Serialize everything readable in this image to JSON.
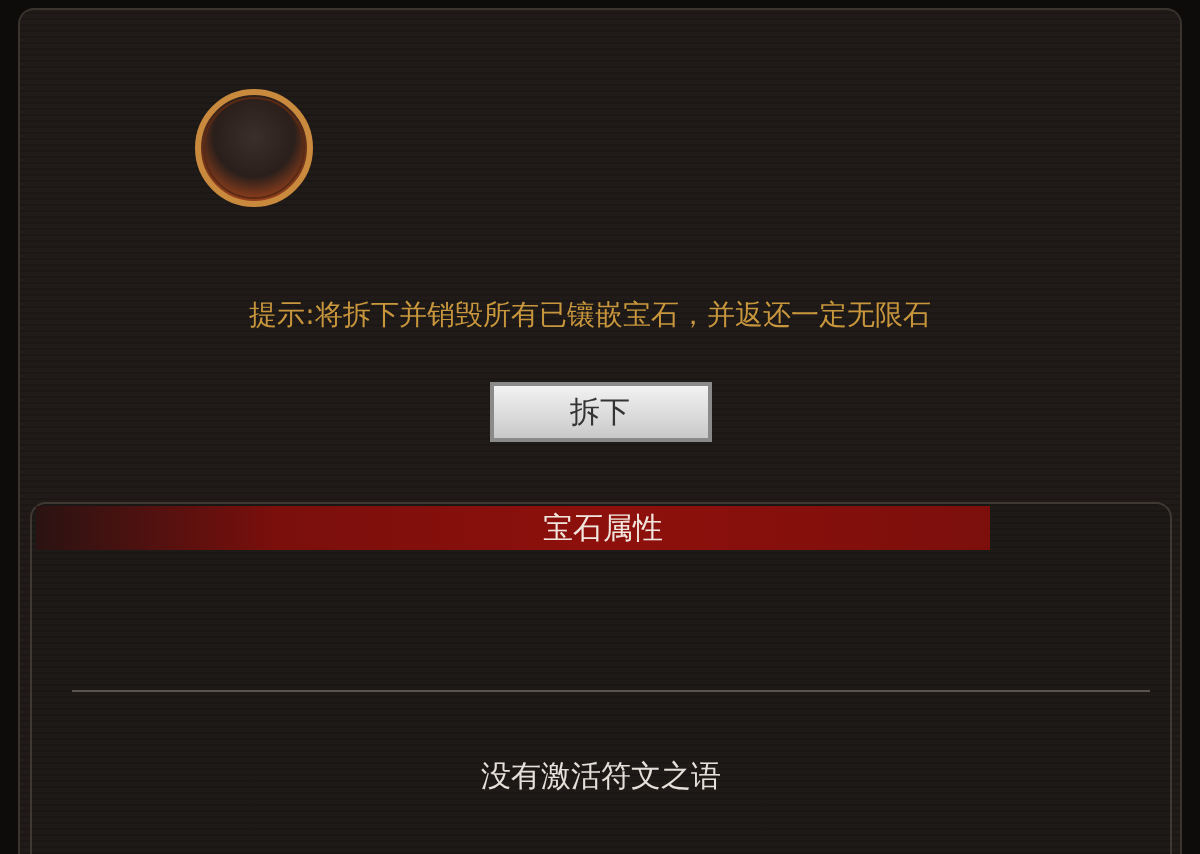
{
  "hint": "提示:将拆下并销毁所有已镶嵌宝石，并返还一定无限石",
  "remove_button": {
    "label": "拆下"
  },
  "attributes_panel": {
    "title": "宝石属性",
    "rune_status": "没有激活符文之语"
  }
}
